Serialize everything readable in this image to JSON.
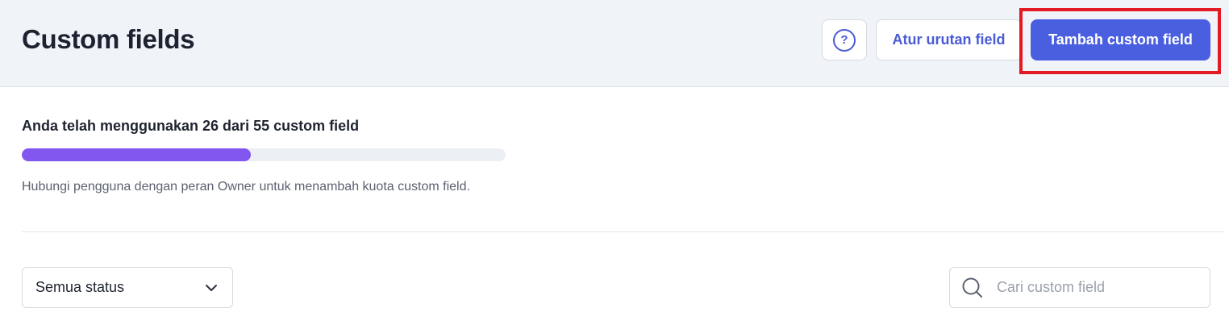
{
  "header": {
    "title": "Custom fields",
    "help_label": "?",
    "order_button_label": "Atur urutan field",
    "add_button_label": "Tambah custom field"
  },
  "usage": {
    "text": "Anda telah menggunakan 26 dari 55 custom field",
    "used": 26,
    "total": 55,
    "progress_percent": 47.3,
    "hint": "Hubungi pengguna dengan peran Owner untuk menambah kuota custom field."
  },
  "filters": {
    "status_value": "Semua status",
    "search_placeholder": "Cari custom field",
    "search_value": ""
  },
  "colors": {
    "accent": "#4a5fe0",
    "progress_fill": "#8257f0",
    "highlight": "#e21a24"
  }
}
